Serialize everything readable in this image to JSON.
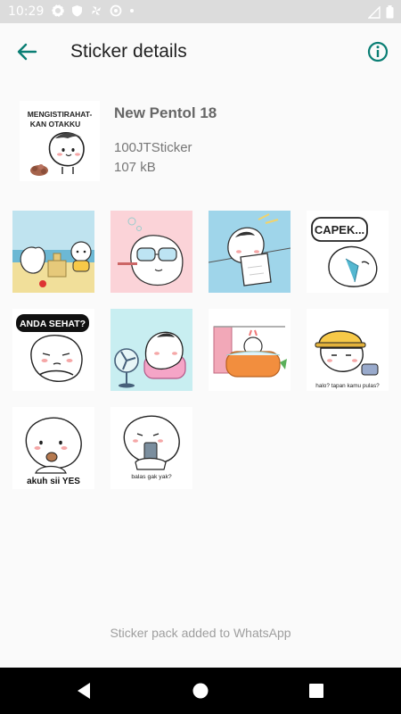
{
  "status_bar": {
    "time": "10:29",
    "icons": [
      "gear-icon",
      "shield-icon",
      "fan-icon",
      "data-saver-icon",
      "dot-icon"
    ],
    "right_icons": [
      "wifi-icon",
      "battery-icon"
    ]
  },
  "app_bar": {
    "back_icon": "arrow-back-icon",
    "title": "Sticker details",
    "info_icon": "info-icon",
    "accent_color": "#0a7e74"
  },
  "pack": {
    "name": "New Pentol 18",
    "publisher": "100JTSticker",
    "size": "107 kB",
    "tray_caption": "MENGISTIRAHAT-\nKAN OTAKKU"
  },
  "stickers": [
    {
      "id": 1,
      "scene": "beach-sandcastle",
      "bg": "#bfe3ef",
      "caption": ""
    },
    {
      "id": 2,
      "scene": "swim-goggles",
      "bg": "#fbd3d8",
      "caption": ""
    },
    {
      "id": 3,
      "scene": "laundry-line",
      "bg": "#9fd5ea",
      "caption": ""
    },
    {
      "id": 4,
      "scene": "tired-crying",
      "bg": "#ffffff",
      "caption": "CAPEK..."
    },
    {
      "id": 5,
      "scene": "arms-crossed",
      "bg": "#ffffff",
      "caption": "ANDA SEHAT?"
    },
    {
      "id": 6,
      "scene": "fan-armchair",
      "bg": "#c8eef1",
      "caption": ""
    },
    {
      "id": 7,
      "scene": "bathtub",
      "bg": "#ffffff",
      "caption": ""
    },
    {
      "id": 8,
      "scene": "hardhat-phone",
      "bg": "#ffffff",
      "caption": "halo? tapan kamu pulas?"
    },
    {
      "id": 9,
      "scene": "eating",
      "bg": "#ffffff",
      "caption": "akuh sii YES"
    },
    {
      "id": 10,
      "scene": "phone-call",
      "bg": "#ffffff",
      "caption": "balas gak yak?"
    }
  ],
  "footer": {
    "message": "Sticker pack added to WhatsApp"
  },
  "nav_bar": {
    "buttons": [
      "back-triangle-icon",
      "home-circle-icon",
      "recents-square-icon"
    ]
  }
}
